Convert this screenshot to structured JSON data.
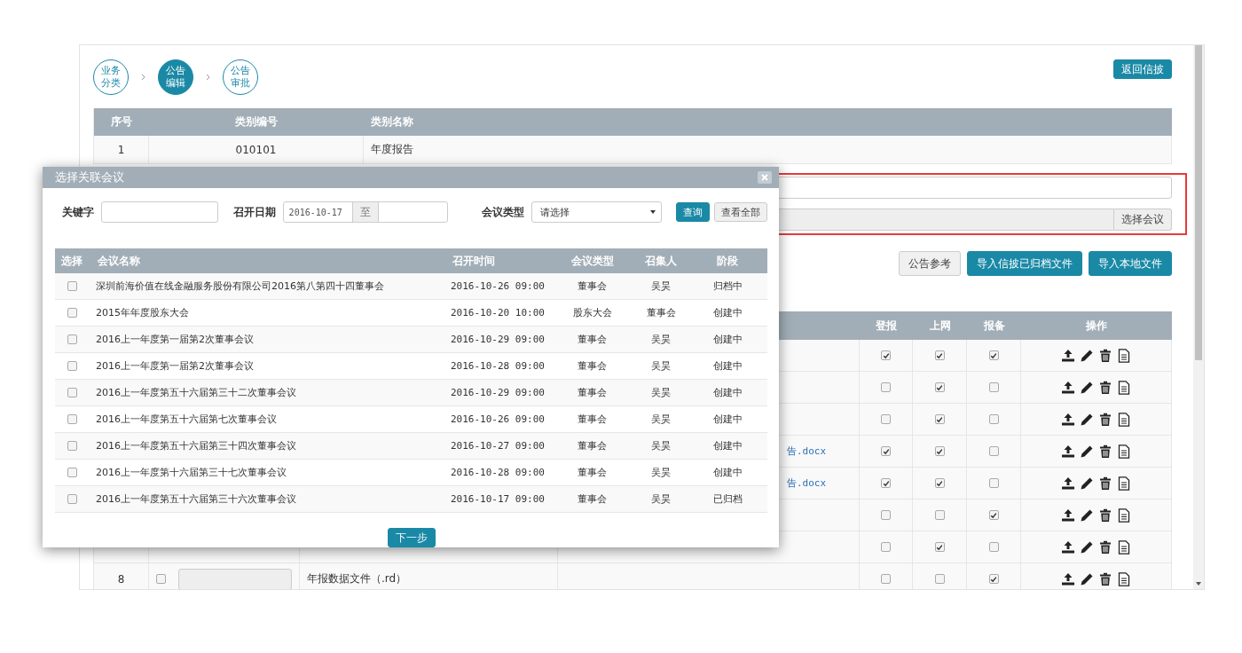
{
  "steps": [
    {
      "label": "业务分类",
      "selected": false
    },
    {
      "label": "公告编辑",
      "selected": true
    },
    {
      "label": "公告审批",
      "selected": false
    }
  ],
  "back_button": "返回信披",
  "category_table": {
    "columns": [
      "序号",
      "类别编号",
      "类别名称"
    ],
    "rows": [
      [
        "1",
        "010101",
        "年度报告"
      ]
    ]
  },
  "meeting_picker": {
    "button": "选择会议"
  },
  "action_buttons": [
    {
      "label": "公告参考",
      "kind": "default"
    },
    {
      "label": "导入信披已归档文件",
      "kind": "primary"
    },
    {
      "label": "导入本地文件",
      "kind": "primary"
    }
  ],
  "file_table": {
    "columns": [
      "登报",
      "上网",
      "报备",
      "操作"
    ],
    "rows": [
      {
        "newspaper": true,
        "online": true,
        "filing": true
      },
      {
        "newspaper": false,
        "online": true,
        "filing": false
      },
      {
        "newspaper": false,
        "online": true,
        "filing": false
      },
      {
        "file": "告.docx",
        "newspaper": true,
        "online": true,
        "filing": false
      },
      {
        "file": "告.docx",
        "newspaper": true,
        "online": true,
        "filing": false
      },
      {
        "newspaper": false,
        "online": false,
        "filing": true
      },
      {
        "newspaper": false,
        "online": true,
        "filing": false
      },
      {
        "index": "8",
        "checked": false,
        "name": "年报数据文件（.rd）",
        "newspaper": false,
        "online": false,
        "filing": true
      }
    ]
  },
  "dialog": {
    "title": "选择关联会议",
    "keyword_label": "关键字",
    "date_label": "召开日期",
    "date_from": "2016-10-17",
    "date_separator": "至",
    "type_label": "会议类型",
    "type_select": "请选择",
    "buttons": [
      {
        "label": "查询",
        "kind": "primary"
      },
      {
        "label": "查看全部",
        "kind": "default"
      }
    ],
    "columns": [
      "选择",
      "会议名称",
      "召开时间",
      "会议类型",
      "召集人",
      "阶段"
    ],
    "rows": [
      {
        "checked": false,
        "name": "深圳前海价值在线金融服务股份有限公司2016第八第四十四董事会",
        "time": "2016-10-26 09:00",
        "type": "董事会",
        "convener": "吴昊",
        "stage": "归档中"
      },
      {
        "checked": false,
        "name": "2015年年度股东大会",
        "time": "2016-10-20 10:00",
        "type": "股东大会",
        "convener": "董事会",
        "stage": "创建中"
      },
      {
        "checked": false,
        "name": "2016上一年度第一届第2次董事会议",
        "time": "2016-10-29 09:00",
        "type": "董事会",
        "convener": "吴昊",
        "stage": "创建中"
      },
      {
        "checked": false,
        "name": "2016上一年度第一届第2次董事会议",
        "time": "2016-10-28 09:00",
        "type": "董事会",
        "convener": "吴昊",
        "stage": "创建中"
      },
      {
        "checked": false,
        "name": "2016上一年度第五十六届第三十二次董事会议",
        "time": "2016-10-29 09:00",
        "type": "董事会",
        "convener": "吴昊",
        "stage": "创建中"
      },
      {
        "checked": false,
        "name": "2016上一年度第五十六届第七次董事会议",
        "time": "2016-10-26 09:00",
        "type": "董事会",
        "convener": "吴昊",
        "stage": "创建中"
      },
      {
        "checked": false,
        "name": "2016上一年度第五十六届第三十四次董事会议",
        "time": "2016-10-27 09:00",
        "type": "董事会",
        "convener": "吴昊",
        "stage": "创建中"
      },
      {
        "checked": false,
        "name": "2016上一年度第十六届第三十七次董事会议",
        "time": "2016-10-28 09:00",
        "type": "董事会",
        "convener": "吴昊",
        "stage": "创建中"
      },
      {
        "checked": false,
        "name": "2016上一年度第五十六届第三十六次董事会议",
        "time": "2016-10-17 09:00",
        "type": "董事会",
        "convener": "吴昊",
        "stage": "已归档"
      }
    ],
    "next_button": "下一步"
  }
}
